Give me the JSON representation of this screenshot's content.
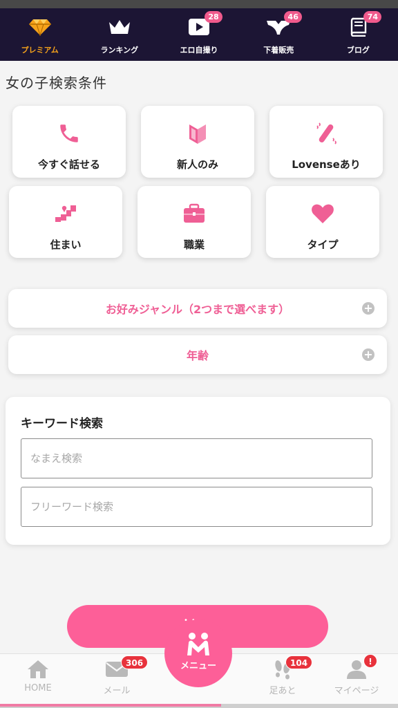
{
  "top_nav": {
    "items": [
      {
        "label": "プレミアム",
        "icon": "diamond-icon",
        "badge": ""
      },
      {
        "label": "ランキング",
        "icon": "crown-icon",
        "badge": ""
      },
      {
        "label": "エロ自撮り",
        "icon": "play-video-icon",
        "badge": "28"
      },
      {
        "label": "下着販売",
        "icon": "underwear-icon",
        "badge": "46"
      },
      {
        "label": "ブログ",
        "icon": "book-icon",
        "badge": "74"
      }
    ],
    "premium_color": "#f6a31b",
    "badge_color": "#f05a8c",
    "background": "#1c1534"
  },
  "search": {
    "title": "女の子検索条件",
    "conditions": [
      {
        "label": "今すぐ話せる",
        "icon": "phone-icon"
      },
      {
        "label": "新人のみ",
        "icon": "beginner-mark-icon"
      },
      {
        "label": "Lovenseあり",
        "icon": "vibrator-icon"
      },
      {
        "label": "住まい",
        "icon": "japan-map-pin-icon"
      },
      {
        "label": "職業",
        "icon": "briefcase-icon"
      },
      {
        "label": "タイプ",
        "icon": "heart-icon"
      }
    ],
    "accent_color": "#ef5f95",
    "genre_label": "お好みジャンル（2つまで選べます）",
    "age_label": "年齢"
  },
  "keyword": {
    "title": "キーワード検索",
    "name_placeholder": "なまえ検索",
    "name_value": "",
    "free_placeholder": "フリーワード検索",
    "free_value": ""
  },
  "bottom_nav": {
    "home": {
      "label": "HOME",
      "icon": "home-icon"
    },
    "mail": {
      "label": "メール",
      "icon": "mail-icon",
      "badge": "306"
    },
    "menu": {
      "label": "メニュー",
      "icon": "people-menu-icon"
    },
    "footprints": {
      "label": "足あと",
      "icon": "footprints-icon",
      "badge": "104"
    },
    "mypage": {
      "label": "マイページ",
      "icon": "user-icon",
      "badge": "!"
    },
    "menu_color": "#fd5f98",
    "badge_color": "#e8323c"
  }
}
